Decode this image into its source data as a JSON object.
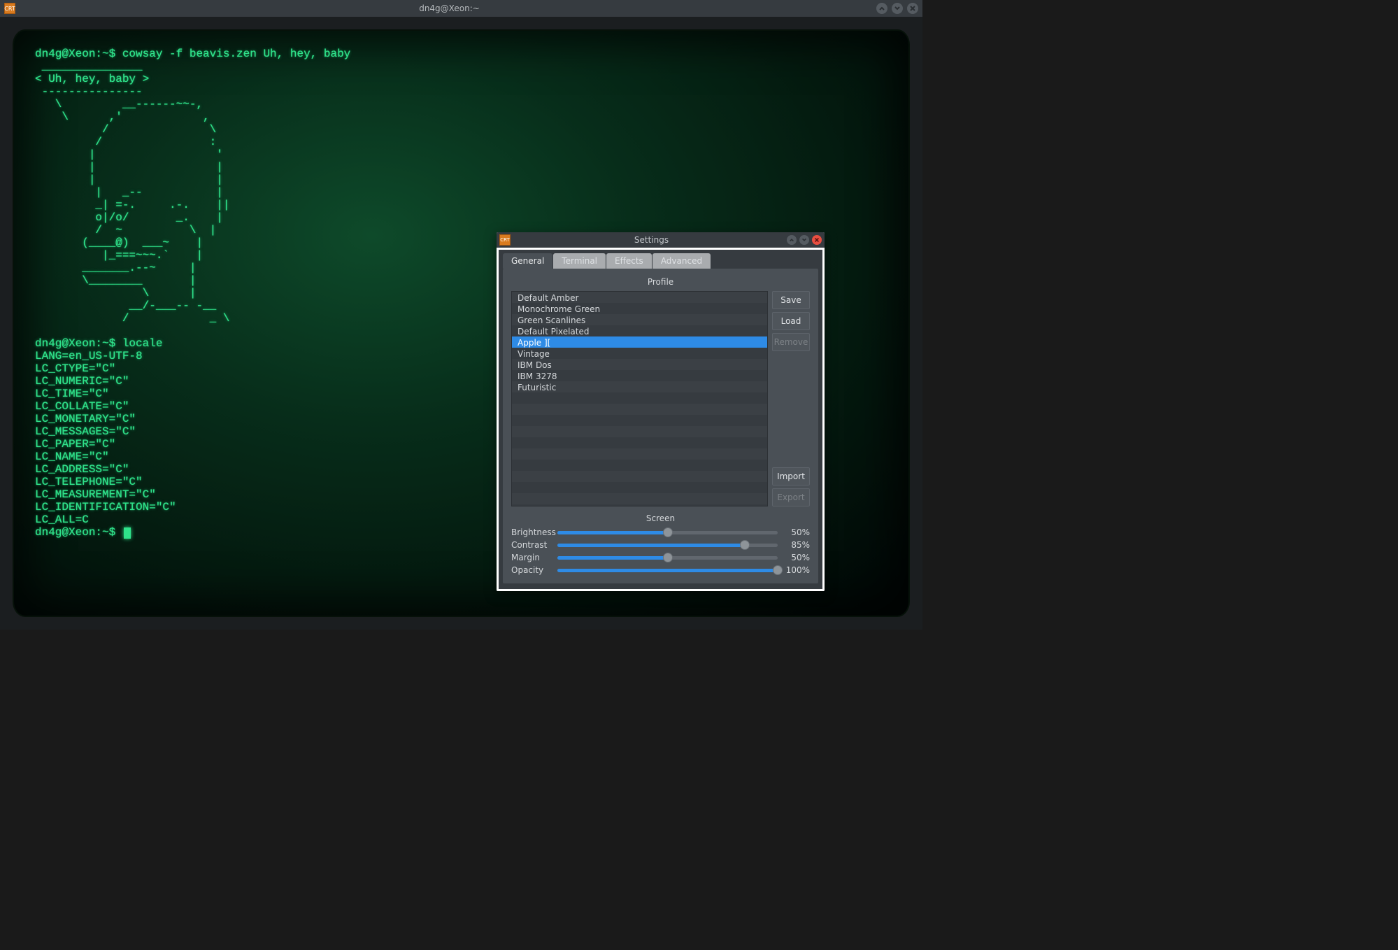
{
  "main_window": {
    "title": "dn4g@Xeon:~",
    "app_icon_label": "CRT"
  },
  "terminal": {
    "lines": [
      "dn4g@Xeon:~$ cowsay -f beavis.zen Uh, hey, baby",
      " _______________",
      "< Uh, hey, baby >",
      " ---------------",
      "   \\         __------~~-,",
      "    \\      ,'            ,",
      "          /               \\",
      "         /                :",
      "        |                  '",
      "        |                  |",
      "        |                  |",
      "         |   _--           |",
      "         _| =-.     .-.    ||",
      "         o|/o/       _.    |",
      "         /  ~          \\  |",
      "       (____@)  ___~    |",
      "          |_===~~~.`    |",
      "       _______.--~     |",
      "       \\________       |",
      "                \\      |",
      "              __/-___-- -__",
      "             /            _ \\",
      "",
      "dn4g@Xeon:~$ locale",
      "LANG=en_US-UTF-8",
      "LC_CTYPE=\"C\"",
      "LC_NUMERIC=\"C\"",
      "LC_TIME=\"C\"",
      "LC_COLLATE=\"C\"",
      "LC_MONETARY=\"C\"",
      "LC_MESSAGES=\"C\"",
      "LC_PAPER=\"C\"",
      "LC_NAME=\"C\"",
      "LC_ADDRESS=\"C\"",
      "LC_TELEPHONE=\"C\"",
      "LC_MEASUREMENT=\"C\"",
      "LC_IDENTIFICATION=\"C\"",
      "LC_ALL=C",
      "dn4g@Xeon:~$ "
    ]
  },
  "settings": {
    "title": "Settings",
    "app_icon_label": "CRT",
    "tabs": [
      "General",
      "Terminal",
      "Effects",
      "Advanced"
    ],
    "active_tab": 0,
    "profile_section_title": "Profile",
    "profiles": [
      "Default Amber",
      "Monochrome Green",
      "Green Scanlines",
      "Default Pixelated",
      "Apple ][",
      "Vintage",
      "IBM Dos",
      "IBM 3278",
      "Futuristic"
    ],
    "selected_profile": 4,
    "empty_rows": 10,
    "buttons": {
      "save": "Save",
      "load": "Load",
      "remove": "Remove",
      "import": "Import",
      "export": "Export"
    },
    "screen_section_title": "Screen",
    "sliders": [
      {
        "label": "Brightness",
        "value": 50,
        "display": "50%"
      },
      {
        "label": "Contrast",
        "value": 85,
        "display": "85%"
      },
      {
        "label": "Margin",
        "value": 50,
        "display": "50%"
      },
      {
        "label": "Opacity",
        "value": 100,
        "display": "100%"
      }
    ]
  }
}
